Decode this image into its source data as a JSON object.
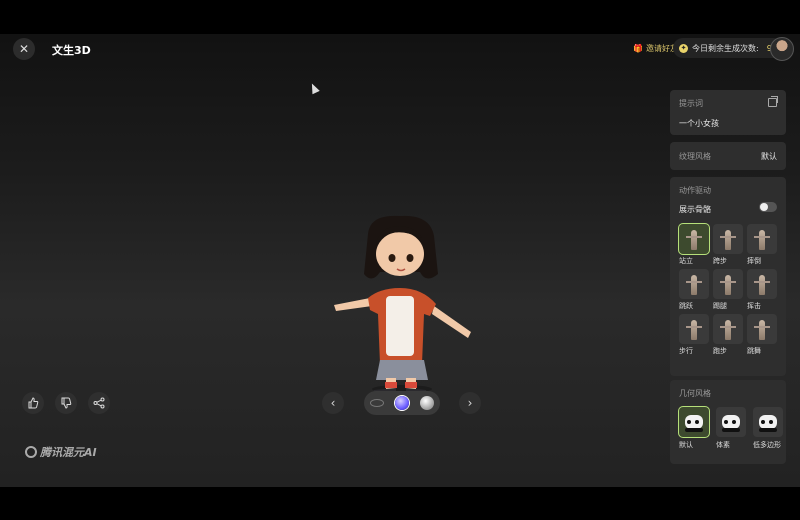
{
  "header": {
    "title": "文生3D",
    "invite_label": "邀请好友",
    "quota_label": "今日剩余生成次数:",
    "quota_value": "92"
  },
  "panel": {
    "prompt": {
      "label": "提示词",
      "value": "一个小女孩"
    },
    "texture": {
      "label": "纹理风格",
      "value": "默认"
    },
    "motion": {
      "label": "动作驱动",
      "skeleton_label": "展示骨骼",
      "skeleton_on": false,
      "items": [
        {
          "label": "站立",
          "selected": true
        },
        {
          "label": "跨步",
          "selected": false
        },
        {
          "label": "摔倒",
          "selected": false
        },
        {
          "label": "跳跃",
          "selected": false
        },
        {
          "label": "踢腿",
          "selected": false
        },
        {
          "label": "挥击",
          "selected": false
        },
        {
          "label": "步行",
          "selected": false
        },
        {
          "label": "跑步",
          "selected": false
        },
        {
          "label": "跳舞",
          "selected": false
        }
      ]
    },
    "geometry": {
      "label": "几何风格",
      "items": [
        {
          "label": "默认",
          "selected": true
        },
        {
          "label": "体素",
          "selected": false
        },
        {
          "label": "低多边形",
          "selected": false
        }
      ]
    }
  },
  "footer": {
    "logo_text": "腾讯混元AI"
  },
  "icons": [
    "close-icon",
    "gift-icon",
    "coin-icon",
    "copy-icon",
    "thumbs-up-icon",
    "thumbs-down-icon",
    "share-icon",
    "chevron-left-icon",
    "chevron-right-icon",
    "rotate-icon"
  ],
  "colors": {
    "accent": "#b6e07a",
    "gold": "#e9d36a",
    "panel_bg": "#2e2e2e"
  }
}
